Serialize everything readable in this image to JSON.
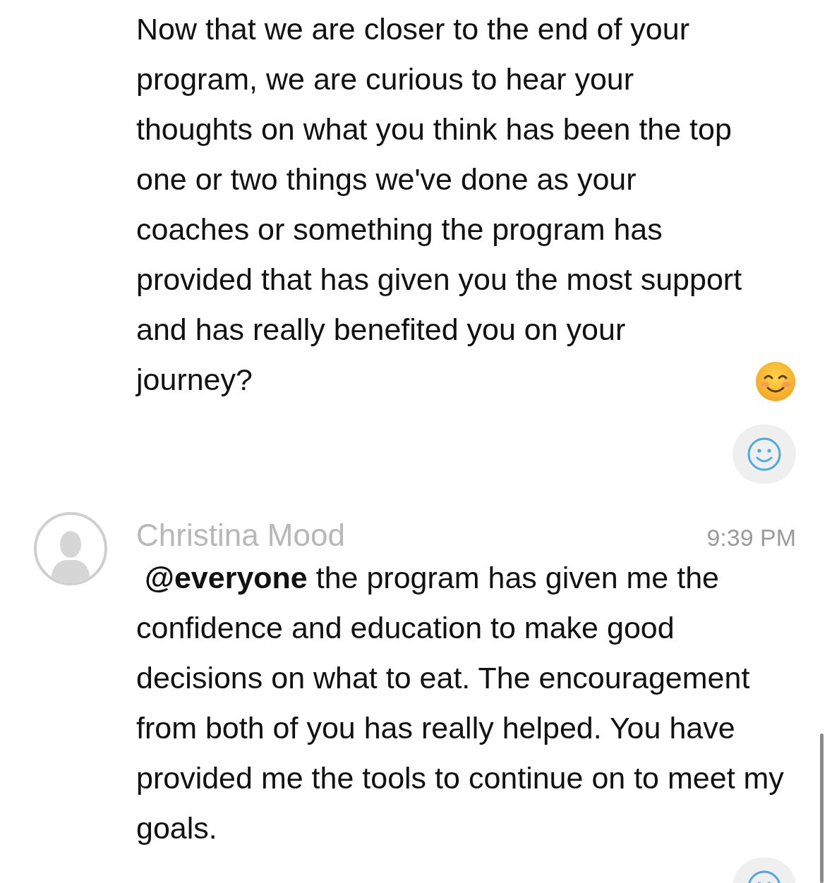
{
  "messages": [
    {
      "kind": "continuation",
      "text": "Now that we are closer to the end of your program, we are curious to hear your thoughts on what you think has been the top one or two things we've done as your coaches or something the program has provided that has given you the most support and has really benefited you on your journey?"
    },
    {
      "kind": "full",
      "author": "Christina Mood",
      "time": "9:39 PM",
      "text": "**@everyone** the program has given me the confidence and education to make good decisions on what to eat. The encouragement from both of you has really helped. You have provided me the tools to continue on to meet my goals."
    }
  ]
}
